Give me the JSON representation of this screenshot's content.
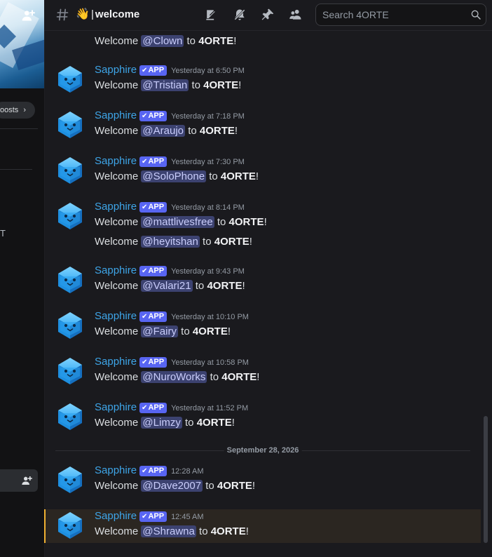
{
  "header": {
    "channel_emoji": "👋",
    "channel_separator": "|",
    "channel_name": "welcome",
    "icons": [
      "threads-icon",
      "mute-bell-icon",
      "pin-icon",
      "members-icon"
    ],
    "search_placeholder": "Search 4ORTE"
  },
  "sidebar": {
    "boosts_label": "oosts",
    "chevron": "›",
    "truncated_text": "T"
  },
  "welcome_prefix": "Welcome",
  "welcome_to": "to",
  "server_name": "4ORTE",
  "bot": {
    "name": "Sapphire",
    "badge": "APP",
    "badge_check": "✔"
  },
  "messages": [
    {
      "type": "continuation",
      "mention": "@Clown"
    },
    {
      "type": "full",
      "timestamp": "Yesterday at 6:50 PM",
      "mention": "@Tristian"
    },
    {
      "type": "full",
      "timestamp": "Yesterday at 7:18 PM",
      "mention": "@Araujo"
    },
    {
      "type": "full",
      "timestamp": "Yesterday at 7:30 PM",
      "mention": "@SoloPhone"
    },
    {
      "type": "full",
      "timestamp": "Yesterday at 8:14 PM",
      "mention": "@mattlivesfree"
    },
    {
      "type": "continuation",
      "mention": "@heyitshan"
    },
    {
      "type": "full",
      "timestamp": "Yesterday at 9:43 PM",
      "mention": "@Valari21"
    },
    {
      "type": "full",
      "timestamp": "Yesterday at 10:10 PM",
      "mention": "@Fairy"
    },
    {
      "type": "full",
      "timestamp": "Yesterday at 10:58 PM",
      "mention": "@NuroWorks"
    },
    {
      "type": "full",
      "timestamp": "Yesterday at 11:52 PM",
      "mention": "@Limzy"
    },
    {
      "type": "full",
      "timestamp": "12:28 AM",
      "mention": "@Dave2007"
    },
    {
      "type": "full",
      "timestamp": "12:45 AM",
      "mention": "@Shrawna"
    }
  ],
  "date_divider": "September 28, 2026",
  "colors": {
    "background": "#1a1a1e",
    "author": "#3ea5e8",
    "badge": "#5865f2",
    "mention_bg": "#3c4270",
    "highlight_bar": "#f0b132"
  }
}
